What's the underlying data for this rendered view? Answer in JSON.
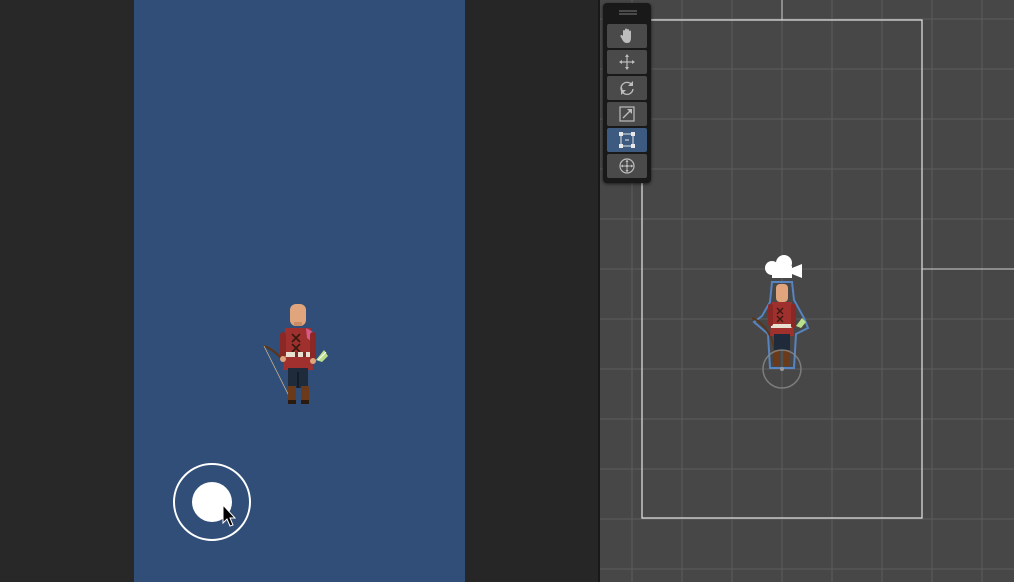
{
  "game_view": {
    "canvas_color": "#304e78",
    "letterbox_color": "#262626"
  },
  "virtual_joystick": {
    "ring_color": "#ffffff",
    "knob_color": "#ffffff"
  },
  "archer_character": {
    "skin_color": "#e0a57c",
    "tunic_color": "#a0302e",
    "pants_color": "#1f2a3a",
    "boots_color": "#6b3a1a",
    "bow_color": "#5a3518",
    "arrow_fletching_color": "#b8e08a"
  },
  "scene_view": {
    "background_color": "#474747",
    "grid_color": "#5c5c5c",
    "camera_bounds_color": "#e6e6e6",
    "selection_outline_color": "#5b8fd6"
  },
  "tool_palette": {
    "tools": [
      {
        "name": "hand-tool",
        "icon": "hand-icon",
        "active": false
      },
      {
        "name": "move-tool",
        "icon": "move-arrows-icon",
        "active": false
      },
      {
        "name": "rotate-tool",
        "icon": "rotate-icon",
        "active": false
      },
      {
        "name": "scale-tool",
        "icon": "scale-icon",
        "active": false
      },
      {
        "name": "rect-tool",
        "icon": "rect-transform-icon",
        "active": true
      },
      {
        "name": "transform-tool",
        "icon": "transform-icon",
        "active": false
      }
    ],
    "active_color": "#3d5a80"
  }
}
